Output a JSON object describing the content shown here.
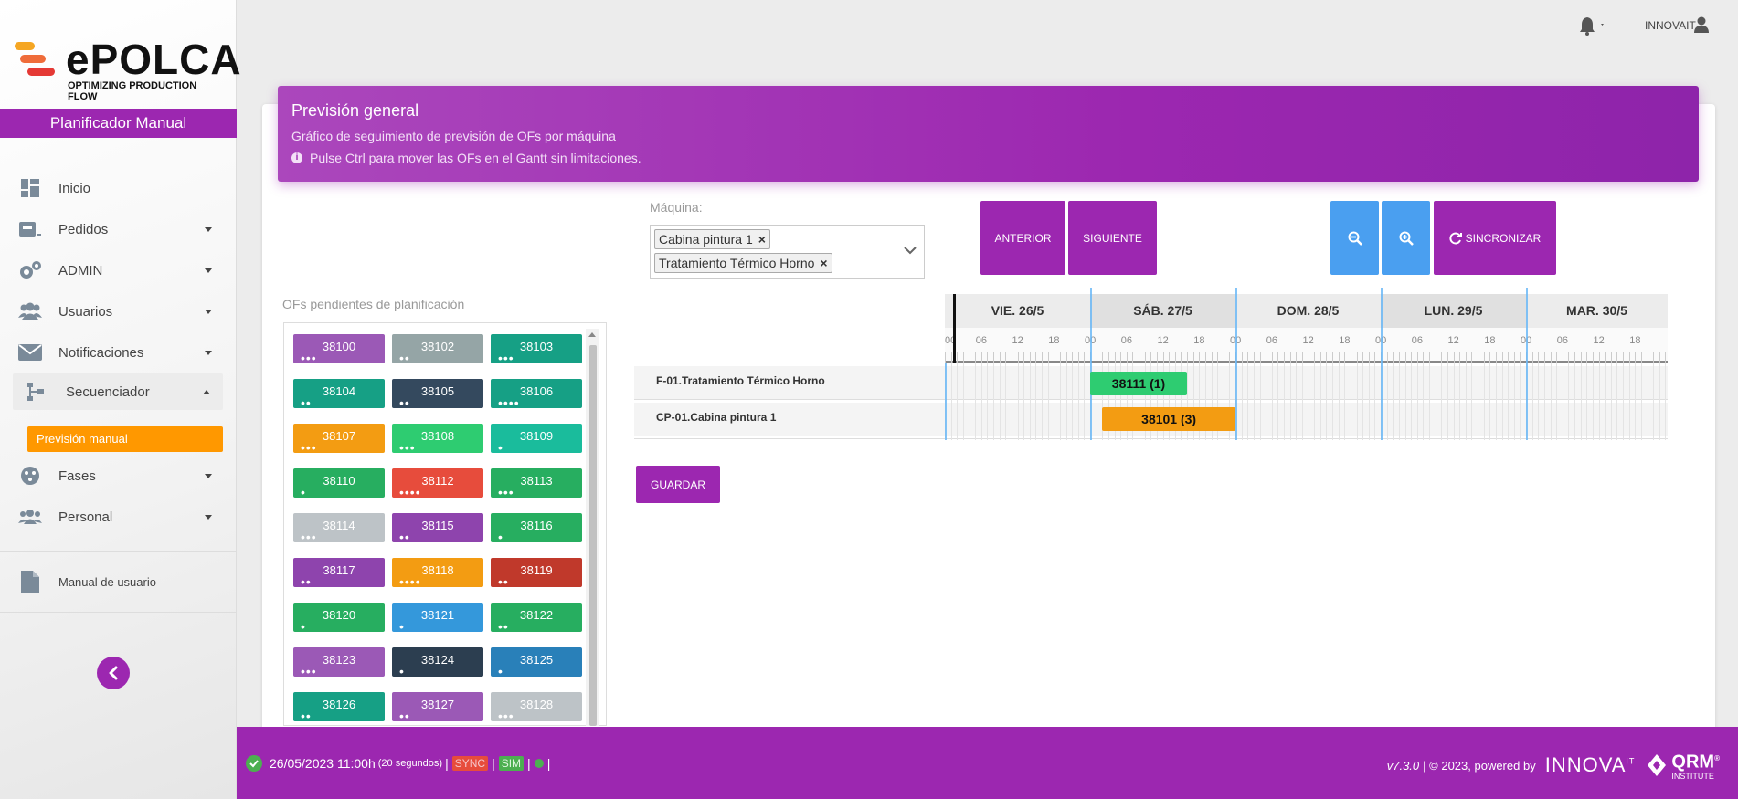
{
  "brand": {
    "name": "ePOLCA",
    "tagline": "OPTIMIZING PRODUCTION FLOW"
  },
  "sidebar": {
    "title": "Planificador Manual",
    "items": [
      {
        "label": "Inicio",
        "icon": "dashboard-icon"
      },
      {
        "label": "Pedidos",
        "icon": "inbox-icon"
      },
      {
        "label": "ADMIN",
        "icon": "gears-icon"
      },
      {
        "label": "Usuarios",
        "icon": "users-icon"
      },
      {
        "label": "Notificaciones",
        "icon": "envelope-icon"
      },
      {
        "label": "Secuenciador",
        "icon": "sitemap-icon"
      },
      {
        "label": "Fases",
        "icon": "fases-icon"
      },
      {
        "label": "Personal",
        "icon": "people-icon"
      }
    ],
    "subitem": "Previsión manual",
    "manual": "Manual de usuario"
  },
  "topbar": {
    "user": "INNOVAIT"
  },
  "card": {
    "title": "Previsión general",
    "subtitle": "Gráfico de seguimiento de previsión de OFs por máquina",
    "hint": "Pulse Ctrl para mover las OFs en el Gantt sin limitaciones."
  },
  "machine": {
    "label": "Máquina:",
    "selected": [
      "Cabina pintura 1",
      "Tratamiento Térmico Horno"
    ]
  },
  "buttons": {
    "prev": "ANTERIOR",
    "next": "SIGUIENTE",
    "sync": "SINCRONIZAR",
    "save": "GUARDAR"
  },
  "pending": {
    "label": "OFs pendientes de planificación",
    "items": [
      {
        "id": "38100",
        "color": "#9b59b6",
        "dots": "•••"
      },
      {
        "id": "38102",
        "color": "#95a5a6",
        "dots": "••"
      },
      {
        "id": "38103",
        "color": "#16a085",
        "dots": "•••"
      },
      {
        "id": "38104",
        "color": "#16a085",
        "dots": "••"
      },
      {
        "id": "38105",
        "color": "#34495e",
        "dots": "••"
      },
      {
        "id": "38106",
        "color": "#16a085",
        "dots": "••••"
      },
      {
        "id": "38107",
        "color": "#f39c12",
        "dots": "•••"
      },
      {
        "id": "38108",
        "color": "#2ecc71",
        "dots": "•••"
      },
      {
        "id": "38109",
        "color": "#1abc9c",
        "dots": "•"
      },
      {
        "id": "38110",
        "color": "#27ae60",
        "dots": "•"
      },
      {
        "id": "38112",
        "color": "#e74c3c",
        "dots": "••••"
      },
      {
        "id": "38113",
        "color": "#27ae60",
        "dots": "•••"
      },
      {
        "id": "38114",
        "color": "#bdc3c7",
        "dots": "•••"
      },
      {
        "id": "38115",
        "color": "#8e44ad",
        "dots": "••"
      },
      {
        "id": "38116",
        "color": "#27ae60",
        "dots": "•"
      },
      {
        "id": "38117",
        "color": "#8e44ad",
        "dots": "••"
      },
      {
        "id": "38118",
        "color": "#f39c12",
        "dots": "••••"
      },
      {
        "id": "38119",
        "color": "#c0392b",
        "dots": "••"
      },
      {
        "id": "38120",
        "color": "#27ae60",
        "dots": "•"
      },
      {
        "id": "38121",
        "color": "#3498db",
        "dots": "•"
      },
      {
        "id": "38122",
        "color": "#27ae60",
        "dots": "••"
      },
      {
        "id": "38123",
        "color": "#9b59b6",
        "dots": "•••"
      },
      {
        "id": "38124",
        "color": "#2c3e50",
        "dots": "•"
      },
      {
        "id": "38125",
        "color": "#2980b9",
        "dots": "•"
      },
      {
        "id": "38126",
        "color": "#16a085",
        "dots": "••"
      },
      {
        "id": "38127",
        "color": "#9b59b6",
        "dots": "••"
      },
      {
        "id": "38128",
        "color": "#bdc3c7",
        "dots": "•••"
      }
    ]
  },
  "gantt": {
    "days": [
      "VIE. 26/5",
      "SÁB. 27/5",
      "DOM. 28/5",
      "LUN. 29/5",
      "MAR. 30/5"
    ],
    "hours": [
      "00",
      "06",
      "12",
      "18"
    ],
    "rows": [
      {
        "label": "F-01.Tratamiento Térmico Horno",
        "task": "38111 (1)",
        "color": "#2ecc71",
        "start": "2023-05-27T00:00",
        "end": "2023-05-27T16:00"
      },
      {
        "label": "CP-01.Cabina pintura 1",
        "task": "38101 (3)",
        "color": "#f39c12",
        "start": "2023-05-27T02:00",
        "end": "2023-05-28T00:00"
      }
    ]
  },
  "footer": {
    "datetime": "26/05/2023 11:00h",
    "interval": "(20 segundos)",
    "sync": "SYNC",
    "sim": "SIM",
    "version": "v7.3.0",
    "copyright": "| © 2023, powered by",
    "innova": "INNOVA",
    "innova_sup": "IT",
    "qrm": "QRM",
    "qrm_sub": "INSTITUTE",
    "qrm_reg": "®"
  },
  "colors": {
    "accent": "#9c27b0",
    "orange": "#ff9800",
    "blue": "#4a9ff0"
  }
}
